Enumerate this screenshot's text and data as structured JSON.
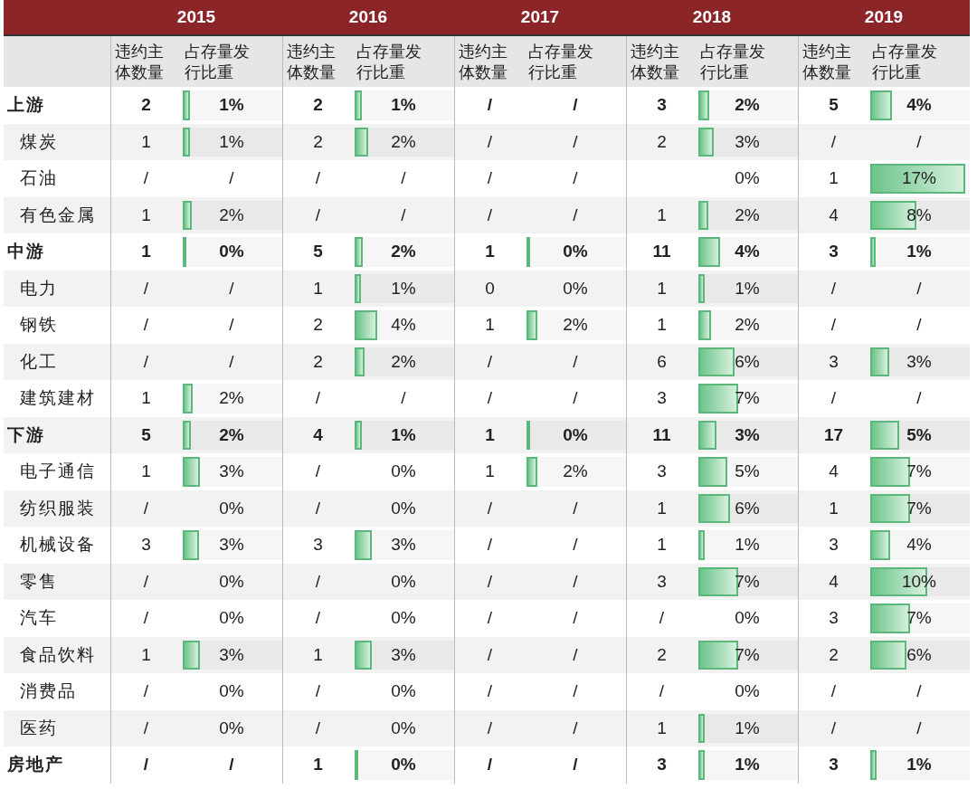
{
  "years": [
    "2015",
    "2016",
    "2017",
    "2018",
    "2019"
  ],
  "subheaders": [
    {
      "count": "违约主体数量",
      "share": "占存量发行比重"
    },
    {
      "count": "违约主体数量",
      "share": "占存量发行比重"
    },
    {
      "count": "违约主体数量",
      "share": "占存量发行比重"
    },
    {
      "count": "违约主体数量",
      "share": "占存量发行比重"
    },
    {
      "count": "违约主体数量",
      "share": "占存量发行比重"
    }
  ],
  "rows": [
    {
      "label": "上游",
      "kind": "group",
      "cells": [
        {
          "count": "2",
          "share": "1%",
          "level": 0.07
        },
        {
          "count": "2",
          "share": "1%",
          "level": 0.07
        },
        {
          "count": "/",
          "share": "/"
        },
        {
          "count": "3",
          "share": "2%",
          "level": 0.11
        },
        {
          "count": "5",
          "share": "4%",
          "level": 0.22
        }
      ]
    },
    {
      "label": "煤炭",
      "kind": "item",
      "cells": [
        {
          "count": "1",
          "share": "1%",
          "level": 0.07
        },
        {
          "count": "2",
          "share": "2%",
          "level": 0.14
        },
        {
          "count": "/",
          "share": "/"
        },
        {
          "count": "2",
          "share": "3%",
          "level": 0.15
        },
        {
          "count": "/",
          "share": "/"
        }
      ]
    },
    {
      "label": "石油",
      "kind": "item",
      "cells": [
        {
          "count": "/",
          "share": "/"
        },
        {
          "count": "/",
          "share": "/"
        },
        {
          "count": "/",
          "share": "/"
        },
        {
          "share": "0%"
        },
        {
          "count": "1",
          "share": "17%",
          "level": 0.95
        }
      ]
    },
    {
      "label": "有色金属",
      "kind": "item",
      "cells": [
        {
          "count": "1",
          "share": "2%",
          "level": 0.09
        },
        {
          "count": "/",
          "share": "/"
        },
        {
          "count": "/",
          "share": "/"
        },
        {
          "count": "1",
          "share": "2%",
          "level": 0.1
        },
        {
          "count": "4",
          "share": "8%",
          "level": 0.46
        }
      ]
    },
    {
      "label": "中游",
      "kind": "group",
      "cells": [
        {
          "count": "1",
          "share": "0%",
          "level": 0.01
        },
        {
          "count": "5",
          "share": "2%",
          "level": 0.08
        },
        {
          "count": "1",
          "share": "0%",
          "level": 0.01
        },
        {
          "count": "11",
          "share": "4%",
          "level": 0.22
        },
        {
          "count": "3",
          "share": "1%",
          "level": 0.05
        }
      ]
    },
    {
      "label": "电力",
      "kind": "item",
      "cells": [
        {
          "count": "/",
          "share": "/"
        },
        {
          "count": "1",
          "share": "1%",
          "level": 0.06
        },
        {
          "count": "0",
          "share": "0%"
        },
        {
          "count": "1",
          "share": "1%",
          "level": 0.06
        },
        {
          "count": "/",
          "share": "/"
        }
      ]
    },
    {
      "label": "钢铁",
      "kind": "item",
      "cells": [
        {
          "count": "/",
          "share": "/"
        },
        {
          "count": "2",
          "share": "4%",
          "level": 0.23
        },
        {
          "count": "1",
          "share": "2%",
          "level": 0.11
        },
        {
          "count": "1",
          "share": "2%",
          "level": 0.13
        },
        {
          "count": "/",
          "share": "/"
        }
      ]
    },
    {
      "label": "化工",
      "kind": "item",
      "cells": [
        {
          "count": "/",
          "share": "/"
        },
        {
          "count": "2",
          "share": "2%",
          "level": 0.1
        },
        {
          "count": "/",
          "share": "/"
        },
        {
          "count": "6",
          "share": "6%",
          "level": 0.36
        },
        {
          "count": "3",
          "share": "3%",
          "level": 0.19
        }
      ]
    },
    {
      "label": "建筑建材",
      "kind": "item",
      "cells": [
        {
          "count": "1",
          "share": "2%",
          "level": 0.1
        },
        {
          "count": "/",
          "share": "/"
        },
        {
          "count": "/",
          "share": "/"
        },
        {
          "count": "3",
          "share": "7%",
          "level": 0.4
        },
        {
          "count": "/",
          "share": "/"
        }
      ]
    },
    {
      "label": "下游",
      "kind": "group",
      "cells": [
        {
          "count": "5",
          "share": "2%",
          "level": 0.08
        },
        {
          "count": "4",
          "share": "1%",
          "level": 0.07
        },
        {
          "count": "1",
          "share": "0%",
          "level": 0.01
        },
        {
          "count": "11",
          "share": "3%",
          "level": 0.18
        },
        {
          "count": "17",
          "share": "5%",
          "level": 0.29
        }
      ]
    },
    {
      "label": "电子通信",
      "kind": "item",
      "cells": [
        {
          "count": "1",
          "share": "3%",
          "level": 0.17
        },
        {
          "count": "/",
          "share": "0%"
        },
        {
          "count": "1",
          "share": "2%",
          "level": 0.11
        },
        {
          "count": "3",
          "share": "5%",
          "level": 0.29
        },
        {
          "count": "4",
          "share": "7%",
          "level": 0.4
        }
      ]
    },
    {
      "label": "纺织服装",
      "kind": "item",
      "cells": [
        {
          "count": "/",
          "share": "0%"
        },
        {
          "count": "/",
          "share": "0%"
        },
        {
          "count": "/",
          "share": "/"
        },
        {
          "count": "1",
          "share": "6%",
          "level": 0.32
        },
        {
          "count": "1",
          "share": "7%",
          "level": 0.4
        }
      ]
    },
    {
      "label": "机械设备",
      "kind": "item",
      "cells": [
        {
          "count": "3",
          "share": "3%",
          "level": 0.16
        },
        {
          "count": "3",
          "share": "3%",
          "level": 0.17
        },
        {
          "count": "/",
          "share": "/"
        },
        {
          "count": "1",
          "share": "1%",
          "level": 0.06
        },
        {
          "count": "3",
          "share": "4%",
          "level": 0.2
        }
      ]
    },
    {
      "label": "零售",
      "kind": "item",
      "cells": [
        {
          "count": "/",
          "share": "0%"
        },
        {
          "count": "/",
          "share": "0%"
        },
        {
          "count": "/",
          "share": "/"
        },
        {
          "count": "3",
          "share": "7%",
          "level": 0.4
        },
        {
          "count": "4",
          "share": "10%",
          "level": 0.57
        }
      ]
    },
    {
      "label": "汽车",
      "kind": "item",
      "cells": [
        {
          "count": "/",
          "share": "0%"
        },
        {
          "count": "/",
          "share": "0%"
        },
        {
          "count": "/",
          "share": "/"
        },
        {
          "count": "/",
          "share": "0%"
        },
        {
          "count": "3",
          "share": "7%",
          "level": 0.4
        }
      ]
    },
    {
      "label": "食品饮料",
      "kind": "item",
      "cells": [
        {
          "count": "1",
          "share": "3%",
          "level": 0.17
        },
        {
          "count": "1",
          "share": "3%",
          "level": 0.17
        },
        {
          "count": "/",
          "share": "/"
        },
        {
          "count": "2",
          "share": "7%",
          "level": 0.4
        },
        {
          "count": "2",
          "share": "6%",
          "level": 0.36
        }
      ]
    },
    {
      "label": "消费品",
      "kind": "item",
      "cells": [
        {
          "count": "/",
          "share": "0%"
        },
        {
          "count": "/",
          "share": "0%"
        },
        {
          "count": "/",
          "share": "/"
        },
        {
          "count": "/",
          "share": "0%"
        },
        {
          "count": "/",
          "share": "/"
        }
      ]
    },
    {
      "label": "医药",
      "kind": "item",
      "cells": [
        {
          "count": "/",
          "share": "0%"
        },
        {
          "count": "/",
          "share": "0%"
        },
        {
          "count": "/",
          "share": "/"
        },
        {
          "count": "1",
          "share": "1%",
          "level": 0.06
        },
        {
          "count": "/",
          "share": "/"
        }
      ]
    },
    {
      "label": "房地产",
      "kind": "group",
      "cells": [
        {
          "count": "/",
          "share": "/"
        },
        {
          "count": "1",
          "share": "0%",
          "level": 0.03
        },
        {
          "count": "/",
          "share": "/"
        },
        {
          "count": "3",
          "share": "1%",
          "level": 0.06
        },
        {
          "count": "3",
          "share": "1%",
          "level": 0.06
        }
      ]
    }
  ]
}
